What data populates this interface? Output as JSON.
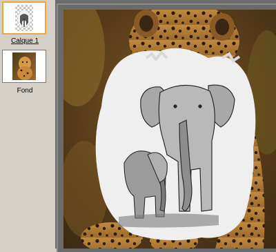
{
  "layers": [
    {
      "name": "Calque 1",
      "selected": true,
      "thumbnail": "elephant-sketch-on-transparent"
    },
    {
      "name": "Fond",
      "selected": false,
      "thumbnail": "leopard-photo"
    }
  ],
  "canvas": {
    "content": "leopard-photo-with-elephant-sketch-layer"
  },
  "colors": {
    "panel": "#d4d0c8",
    "canvas_bg": "#6b6b6b",
    "selected_border": "#f0a830"
  }
}
